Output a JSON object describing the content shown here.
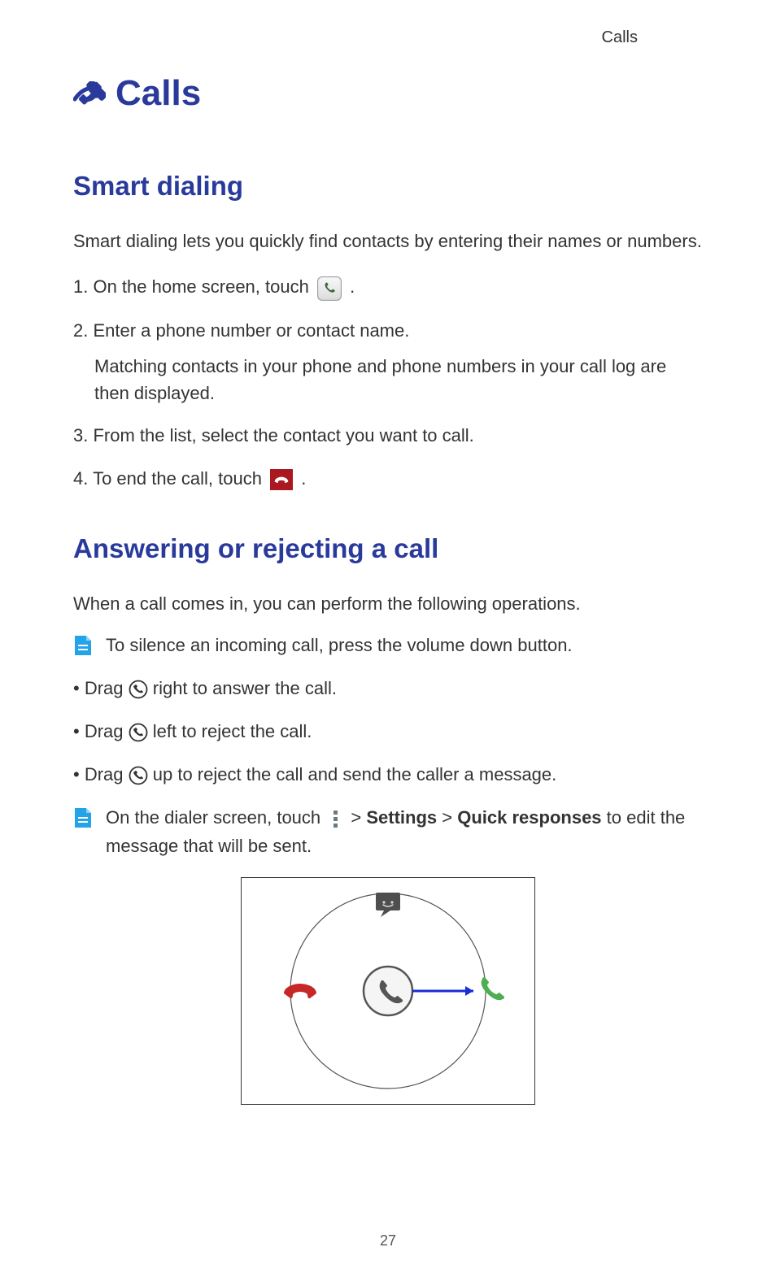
{
  "running_header": "Calls",
  "page_number": "27",
  "chapter_title": "Calls",
  "section1": {
    "title": "Smart dialing",
    "intro": "Smart dialing lets you quickly find contacts by entering their names or numbers.",
    "steps": {
      "s1_pre": "1. On the home screen, touch ",
      "s1_post": " .",
      "s2_main": "2. Enter a phone number or contact name.",
      "s2_sub": "Matching contacts in your phone and phone numbers in your call log are then displayed.",
      "s3": "3. From the list, select the contact you want to call.",
      "s4_pre": "4. To end the call, touch ",
      "s4_post": " ."
    }
  },
  "section2": {
    "title": "Answering or rejecting a call",
    "intro": "When a call comes in, you can perform the following operations.",
    "note1": "To silence an incoming call, press the volume down button.",
    "bullets": {
      "b1_pre": "Drag ",
      "b1_post": " right to answer the call.",
      "b2_pre": "Drag ",
      "b2_post": " left to reject the call.",
      "b3_pre": "Drag ",
      "b3_post": " up to reject the call and send the caller a message."
    },
    "note2": {
      "part1": "On the dialer screen, touch ",
      "gt1": " > ",
      "bold1": "Settings",
      "gt2": " > ",
      "bold2": "Quick responses",
      "part2": " to edit the message that will be sent."
    }
  },
  "icons": {
    "chapter": "phone-chapter-icon",
    "dialer": "dialer-app-icon",
    "endcall": "end-call-icon",
    "note_doc": "note-doc-icon",
    "circle_phone": "incoming-call-handle-icon",
    "overflow": "overflow-menu-icon"
  }
}
